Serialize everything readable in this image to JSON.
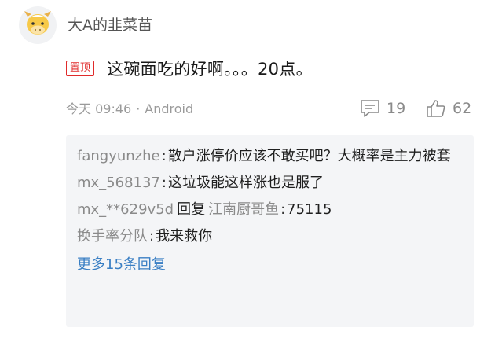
{
  "comment": {
    "username": "大A的韭菜苗",
    "pin_label": "置顶",
    "text": "这碗面吃的好啊。。。20点。",
    "timestamp": "今天 09:46",
    "separator": "·",
    "platform": "Android",
    "reply_count": "19",
    "like_count": "62",
    "avatar_icon": "cow-avatar-icon",
    "colors": {
      "pin": "#e02a2a",
      "link": "#3a7fc4",
      "muted": "#9a9a9a",
      "replies_bg": "#f4f5f7"
    }
  },
  "replies": [
    {
      "user": "fangyunzhe",
      "sep": ":",
      "text": "散户涨停价应该不敢买吧？大概率是主力被套"
    },
    {
      "user": "mx_568137",
      "sep": ":",
      "text": "这垃圾能这样涨也是服了"
    },
    {
      "user": "mx_**629v5d",
      "reply_keyword": "回复",
      "reply_to": "江南厨哥鱼",
      "sep": ":",
      "text": "75115"
    },
    {
      "user": "换手率分队",
      "sep": ":",
      "text": "我来救你"
    }
  ],
  "more_replies_label": "更多15条回复",
  "icons": {
    "comment": "comment-icon",
    "like": "thumbs-up-icon"
  }
}
